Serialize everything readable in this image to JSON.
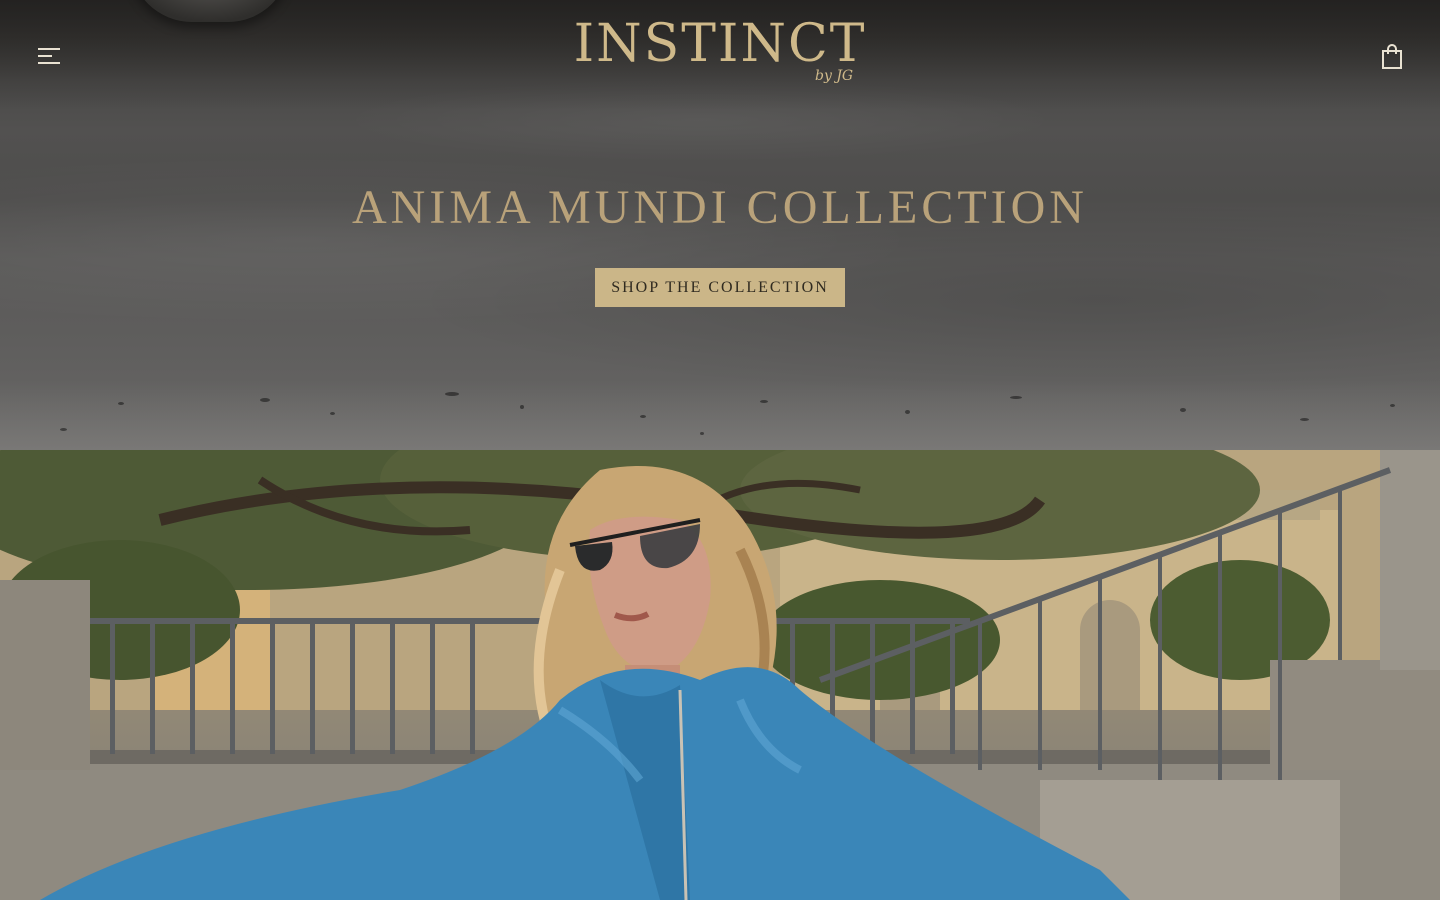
{
  "header": {
    "menu_icon": "hamburger-menu-icon",
    "cart_icon": "shopping-bag-icon",
    "logo": {
      "text": "INSTINCT",
      "subtext": "by JG"
    }
  },
  "hero": {
    "title": "ANIMA MUNDI COLLECTION",
    "cta_label": "SHOP THE COLLECTION"
  },
  "colors": {
    "gold": "#cfb98a",
    "title_gold": "#b9a27a",
    "button_bg": "#cbb688",
    "button_text": "#2f2a20"
  }
}
